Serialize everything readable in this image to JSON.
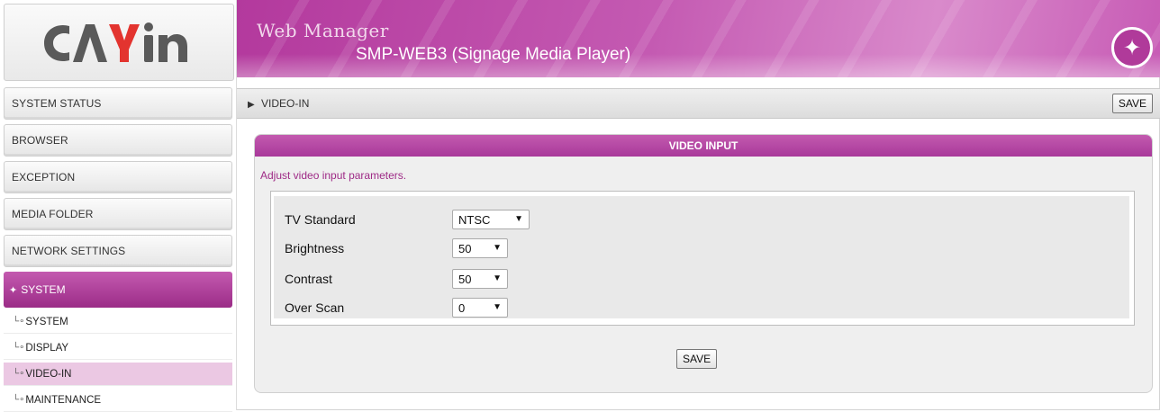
{
  "brand": {
    "logo_text": "CAYIN"
  },
  "header": {
    "subtitle": "Web Manager",
    "product": "SMP-WEB3 (Signage Media Player)"
  },
  "sidebar": {
    "items": [
      {
        "label": "SYSTEM STATUS"
      },
      {
        "label": "BROWSER"
      },
      {
        "label": "EXCEPTION"
      },
      {
        "label": "MEDIA FOLDER"
      },
      {
        "label": "NETWORK SETTINGS"
      }
    ],
    "active": {
      "label": "SYSTEM"
    },
    "subitems": [
      {
        "label": "SYSTEM"
      },
      {
        "label": "DISPLAY"
      },
      {
        "label": "VIDEO-IN"
      },
      {
        "label": "MAINTENANCE"
      }
    ],
    "selected_subitem": "VIDEO-IN"
  },
  "breadcrumb": {
    "label": "VIDEO-IN"
  },
  "buttons": {
    "save": "SAVE"
  },
  "panel": {
    "title": "VIDEO INPUT",
    "description": "Adjust video input parameters.",
    "fields": [
      {
        "label": "TV Standard",
        "value": "NTSC"
      },
      {
        "label": "Brightness",
        "value": "50"
      },
      {
        "label": "Contrast",
        "value": "50"
      },
      {
        "label": "Over Scan",
        "value": "0"
      }
    ]
  },
  "colors": {
    "brand_magenta": "#a8399a",
    "selected_highlight": "#ebc8e3",
    "description_text": "#9e2a86"
  },
  "icons": [
    "wand-icon",
    "star-icon",
    "triangle-right-icon",
    "chevron-down-icon",
    "sub-item-branch-icon"
  ]
}
